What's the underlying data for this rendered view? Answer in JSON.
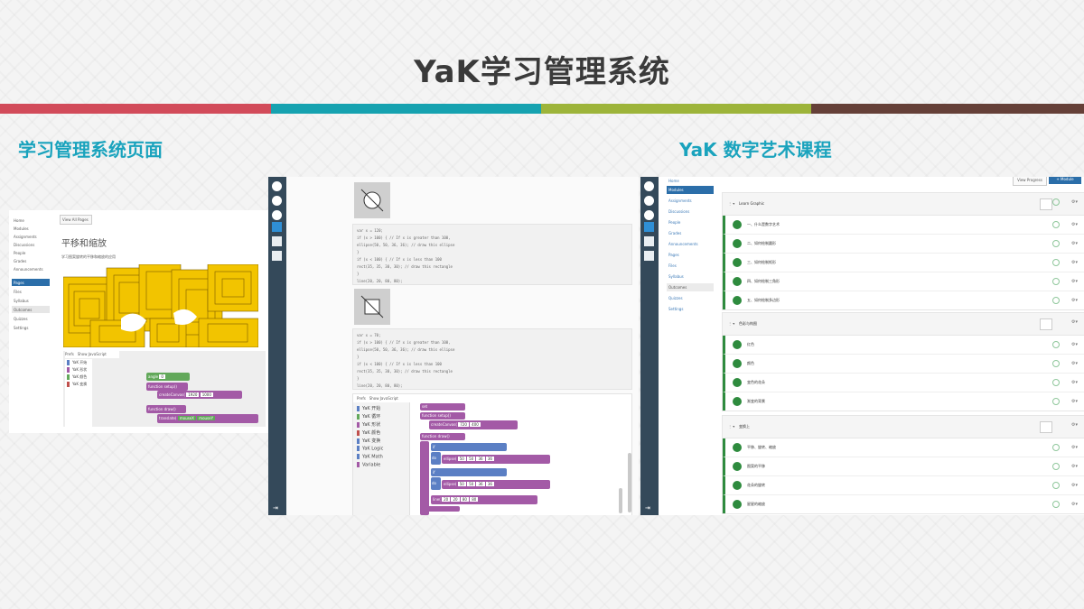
{
  "slide": {
    "title": "YaK学习管理系统",
    "subtitle_left": "学习管理系统页面",
    "subtitle_right": "YaK 数字艺术课程",
    "stripe_colors": [
      "#d24b5a",
      "#16a2b0",
      "#9db43a",
      "#654038"
    ]
  },
  "lms_course_page": {
    "nav": [
      "Home",
      "Modules",
      "Assignments",
      "Discussions",
      "People",
      "Grades",
      "Announcements",
      "Pages",
      "Files",
      "Syllabus",
      "Outcomes",
      "Quizzes",
      "Settings"
    ],
    "active_nav": "Pages",
    "view_all_pages": "View All Pages",
    "page_title": "平移和缩放",
    "page_subtitle": "学习图案旋转的平移和缩放的应用",
    "tabs": [
      "Prefs",
      "Show JavaScript"
    ],
    "categories": [
      "YaK 开始",
      "YaK 形状",
      "YaK 颜色",
      "YaK 变换"
    ],
    "blocks": [
      "angle",
      "function setup()",
      "createCanvas(",
      "function draw()",
      "translate("
    ],
    "values": [
      "0",
      "1920",
      "1000",
      "mouseX",
      "mouseY"
    ]
  },
  "code_editor": {
    "snippet_1": [
      "var x = 120;",
      "if (x > 100) { // If x is greater than 100,",
      "    ellipse(50, 50, 36, 36); // draw this ellipse",
      "}",
      "if (x < 100) { // If x is less than 100",
      "    rect(35, 35, 30, 30); // draw this rectangle",
      "}",
      "line(20, 20, 80, 80);"
    ],
    "snippet_2": [
      "var x = 70;",
      "if (x > 100) { // If x is greater than 100,",
      "    ellipse(50, 50, 36, 36); // draw this ellipse",
      "}",
      "if (x < 100) { // If x is less than 100",
      "    rect(35, 35, 30, 30); // draw this rectangle",
      "}",
      "line(20, 20, 80, 80);"
    ],
    "tabs": [
      "Prefs",
      "Show JavaScript"
    ],
    "categories": [
      "YaK 开始",
      "YaK 循环",
      "YaK 形状",
      "YaK 颜色",
      "YaK 变换",
      "YaK Logic",
      "YaK Math",
      "Variable"
    ],
    "blocks": [
      "set",
      "function setup()",
      "createCanvas(",
      "function draw()",
      "if",
      "do",
      "ellipse(",
      "line("
    ],
    "values": [
      "720",
      "400",
      "50",
      "36",
      "0",
      "20",
      "80"
    ]
  },
  "modules_page": {
    "nav": [
      "Home",
      "Modules",
      "Assignments",
      "Discussions",
      "People",
      "Grades",
      "Announcements",
      "Pages",
      "Files",
      "Syllabus",
      "Outcomes",
      "Quizzes",
      "Settings"
    ],
    "active_nav": "Modules",
    "view_progress": "View Progress",
    "module_button": "+ Module",
    "modules": [
      {
        "name": "Learn Graphic",
        "items": [
          "一、什么是数字艺术",
          "二、如何绘制圆形",
          "三、如何绘制矩形",
          "四、如何绘制三角形",
          "五、如何绘制多边形"
        ]
      },
      {
        "name": "色彩与构图",
        "items": [
          "红色",
          "颜色",
          "变色的花朵",
          "渐变的背景"
        ]
      },
      {
        "name": "变换上",
        "items": [
          "平移、旋转、缩放",
          "图案的平移",
          "花朵的旋转",
          "星星的缩放"
        ]
      }
    ]
  },
  "colors": {
    "accent": "#1aa3bd",
    "nav_active": "#2b6ea9",
    "dark_sidebar": "#34495a",
    "module_green": "#2e8b3e",
    "art_yellow": "#f2c400",
    "block_purple": "#a35aa6",
    "block_blue": "#5b7fc4",
    "block_green": "#62a85a"
  }
}
